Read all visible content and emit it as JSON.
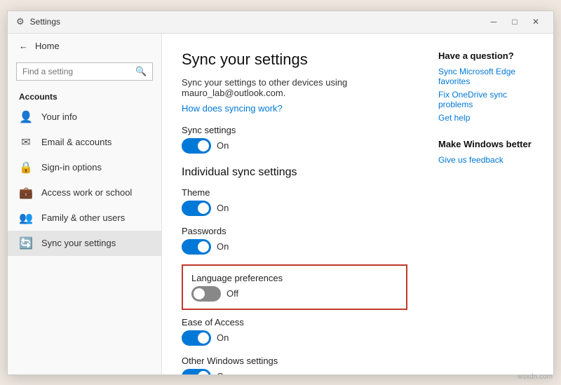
{
  "window": {
    "title": "Settings",
    "min_btn": "─",
    "max_btn": "□",
    "close_btn": "✕"
  },
  "sidebar": {
    "home_label": "Home",
    "search_placeholder": "Find a setting",
    "section_label": "Accounts",
    "items": [
      {
        "id": "your-info",
        "label": "Your info",
        "icon": "👤"
      },
      {
        "id": "email-accounts",
        "label": "Email & accounts",
        "icon": "✉"
      },
      {
        "id": "sign-in",
        "label": "Sign-in options",
        "icon": "🔒"
      },
      {
        "id": "work-school",
        "label": "Access work or school",
        "icon": "💼"
      },
      {
        "id": "family",
        "label": "Family & other users",
        "icon": "👥"
      },
      {
        "id": "sync",
        "label": "Sync your settings",
        "icon": "🔄"
      }
    ]
  },
  "main": {
    "title": "Sync your settings",
    "description": "Sync your settings to other devices using mauro_lab@outlook.com.",
    "how_link": "How does syncing work?",
    "sync_settings_label": "Sync settings",
    "sync_settings_state": "On",
    "sync_settings_on": true,
    "individual_section": "Individual sync settings",
    "settings": [
      {
        "id": "theme",
        "label": "Theme",
        "state": "On",
        "on": true,
        "highlight": false
      },
      {
        "id": "passwords",
        "label": "Passwords",
        "state": "On",
        "on": true,
        "highlight": false
      },
      {
        "id": "language",
        "label": "Language preferences",
        "state": "Off",
        "on": false,
        "highlight": true
      },
      {
        "id": "ease",
        "label": "Ease of Access",
        "state": "On",
        "on": true,
        "highlight": false
      },
      {
        "id": "other",
        "label": "Other Windows settings",
        "state": "On",
        "on": true,
        "highlight": false
      }
    ]
  },
  "right_panel": {
    "help_title": "Have a question?",
    "links": [
      "Sync Microsoft Edge favorites",
      "Fix OneDrive sync problems",
      "Get help"
    ],
    "feedback_title": "Make Windows better",
    "feedback_link": "Give us feedback"
  },
  "watermark": "wsxdn.com"
}
